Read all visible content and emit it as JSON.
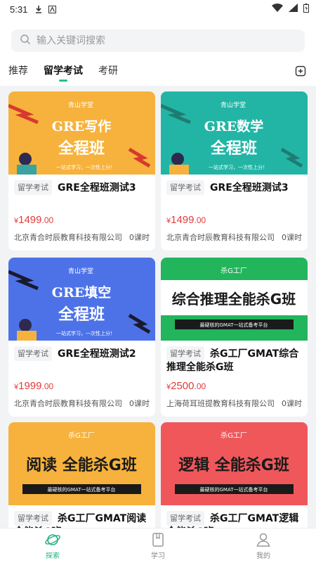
{
  "status_bar": {
    "time": "5:31"
  },
  "search": {
    "placeholder": "输入关键词搜索"
  },
  "tabs": [
    {
      "label": "推荐",
      "active": false
    },
    {
      "label": "留学考试",
      "active": true
    },
    {
      "label": "考研",
      "active": false
    }
  ],
  "cards": [
    {
      "banner": {
        "bg": "#f6b23c",
        "brand": "青山学堂",
        "line1": "GRE写作",
        "line2": "全程班",
        "slogan": "一站式学习，一次性上分！"
      },
      "tag": "留学考试",
      "title": "GRE全程班测试3",
      "price_symbol": "¥",
      "price_int": "1499",
      "price_dec": ".00",
      "org": "北京青合时辰教育科技有限公司",
      "lessons": "0课时"
    },
    {
      "banner": {
        "bg": "#22b5a5",
        "brand": "青山学堂",
        "line1": "GRE数学",
        "line2": "全程班",
        "slogan": "一站式学习，一次性上分！"
      },
      "tag": "留学考试",
      "title": "GRE全程班测试3",
      "price_symbol": "¥",
      "price_int": "1499",
      "price_dec": ".00",
      "org": "北京青合时辰教育科技有限公司",
      "lessons": "0课时"
    },
    {
      "banner": {
        "bg": "#4d72e8",
        "brand": "青山学堂",
        "line1": "GRE填空",
        "line2": "全程班",
        "slogan": "一站式学习，一次性上分！"
      },
      "tag": "留学考试",
      "title": "GRE全程班测试2",
      "price_symbol": "¥",
      "price_int": "1999",
      "price_dec": ".00",
      "org": "北京青合时辰教育科技有限公司",
      "lessons": "0课时"
    },
    {
      "banner": {
        "bg": "#22b55c",
        "brand": "杀G工厂",
        "line1": "综合推理全能杀G班",
        "line2": "",
        "slogan": "最硬核的GMAT一站式备考平台"
      },
      "tag": "留学考试",
      "title": "杀G工厂GMAT综合推理全能杀G班",
      "price_symbol": "¥",
      "price_int": "2500",
      "price_dec": ".00",
      "org": "上海荷耳班提教育科技有限公司",
      "lessons": "0课时"
    },
    {
      "banner": {
        "bg": "#f6b23c",
        "brand": "杀G工厂",
        "line1": "阅读  全能杀G班",
        "line2": "",
        "slogan": "最硬核的GMAT一站式备考平台"
      },
      "tag": "留学考试",
      "title": "杀G工厂GMAT阅读全能杀G班",
      "price_symbol": "",
      "price_int": "",
      "price_dec": "",
      "org": "",
      "lessons": ""
    },
    {
      "banner": {
        "bg": "#f0575b",
        "brand": "杀G工厂",
        "line1": "逻辑  全能杀G班",
        "line2": "",
        "slogan": "最硬核的GMAT一站式备考平台"
      },
      "tag": "留学考试",
      "title": "杀G工厂GMAT逻辑全能杀G班",
      "price_symbol": "",
      "price_int": "",
      "price_dec": "",
      "org": "",
      "lessons": ""
    }
  ],
  "bottom_nav": [
    {
      "label": "探索",
      "icon": "planet-icon",
      "active": true
    },
    {
      "label": "学习",
      "icon": "book-icon",
      "active": false
    },
    {
      "label": "我的",
      "icon": "user-icon",
      "active": false
    }
  ],
  "colors": {
    "accent": "#22b07d",
    "price": "#e23b3b"
  }
}
